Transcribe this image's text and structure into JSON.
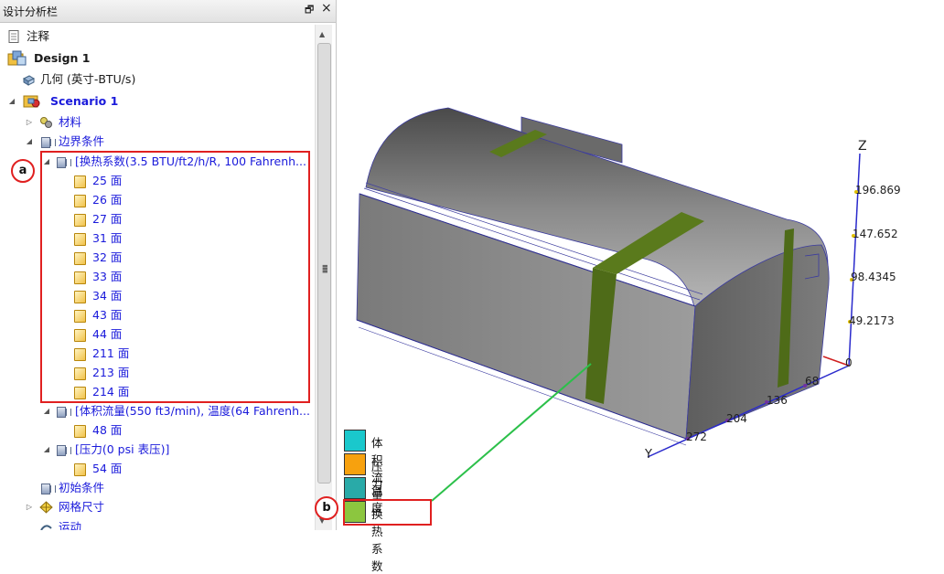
{
  "panel": {
    "title": "设计分析栏",
    "pin_glyph": "🗗",
    "close_glyph": "×"
  },
  "tree": {
    "notes": "注释",
    "design": "Design 1",
    "geometry": "几何 (英寸-BTU/s)",
    "scenario": "Scenario 1",
    "materials": "材料",
    "boundary": "边界条件",
    "htc": "[换热系数(3.5 BTU/ft2/h/R, 100 Fahrenh...",
    "htc_faces": [
      "25 面",
      "26 面",
      "27 面",
      "31 面",
      "32 面",
      "33 面",
      "34 面",
      "43 面",
      "44 面",
      "211 面",
      "213 面",
      "214 面"
    ],
    "flow": "[体积流量(550 ft3/min), 温度(64 Fahrenh...",
    "flow_face": "48 面",
    "pressure": "[压力(0 psi 表压)]",
    "pressure_face": "54 面",
    "initial": "初始条件",
    "mesh": "网格尺寸",
    "motion": "运动"
  },
  "annotations": {
    "a": "a",
    "b": "b"
  },
  "legend": [
    {
      "label": "体积流量",
      "color": "#1ac8cc"
    },
    {
      "label": "压力",
      "color": "#f7a10e"
    },
    {
      "label": "温度",
      "color": "#29aaa8"
    },
    {
      "label": "换热系数",
      "color": "#8cc63f"
    }
  ],
  "axes": {
    "z_label": "Z",
    "y_label": "Y",
    "z_ticks": [
      "196.869",
      "147.652",
      "98.4345",
      "49.2173",
      "0"
    ],
    "y_ticks": [
      "68",
      "136",
      "204",
      "272"
    ]
  }
}
